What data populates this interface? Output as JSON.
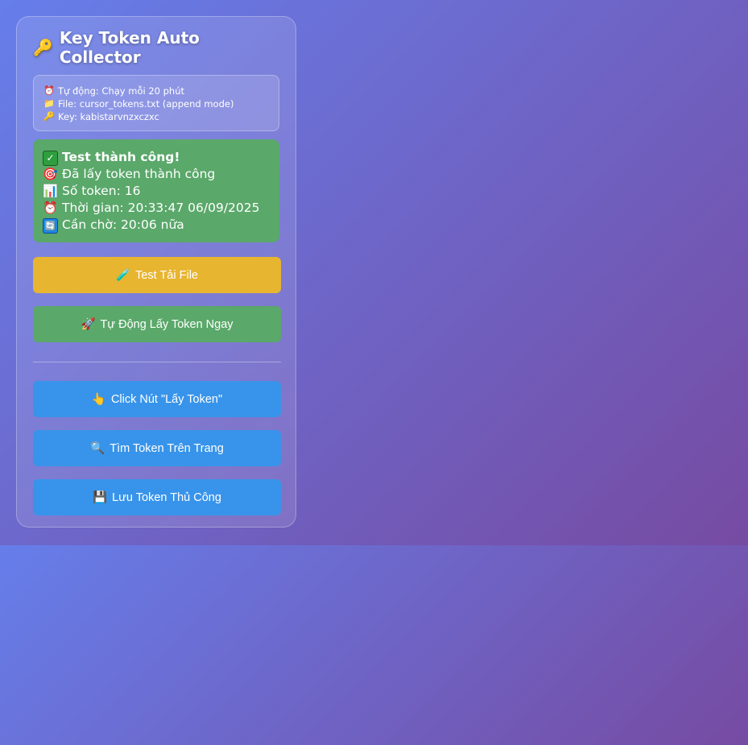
{
  "panel": {
    "title": "Key Token Auto Collector",
    "title_icon": "🔑",
    "info": [
      {
        "icon": "⏰",
        "text": "Tự động: Chạy mỗi 20 phút"
      },
      {
        "icon": "📁",
        "text": "File: cursor_tokens.txt (append mode)"
      },
      {
        "icon": "🔑",
        "text": "Key: kabistarvnzxczxc"
      }
    ],
    "status": {
      "line1": {
        "icon": "✓",
        "text": "Test thành công!"
      },
      "line2": {
        "icon": "🎯",
        "text": "Đã lấy token thành công"
      },
      "line3": {
        "icon": "📊",
        "text": "Số token: 16"
      },
      "line4": {
        "icon": "⏰",
        "text": "Thời gian: 20:33:47 06/09/2025"
      },
      "line5": {
        "icon": "🔄",
        "text": "Cần chờ: 20:06 nữa"
      }
    },
    "buttons": {
      "test_download": {
        "icon": "🧪",
        "label": "Test Tải File"
      },
      "auto_get": {
        "icon": "🚀",
        "label": "Tự Động Lấy Token Ngay"
      },
      "click_get": {
        "icon": "👆",
        "label": "Click Nút \"Lấy Token\""
      },
      "find_token": {
        "icon": "🔍",
        "label": "Tìm Token Trên Trang"
      },
      "save_manual": {
        "icon": "💾",
        "label": "Lưu Token Thủ Công"
      }
    }
  },
  "colors": {
    "background_start": "#667eea",
    "background_end": "#764ba2",
    "status_green": "#5aa86a",
    "button_yellow": "#e8b531",
    "button_green": "#5aa86a",
    "button_blue": "#3894ea"
  }
}
